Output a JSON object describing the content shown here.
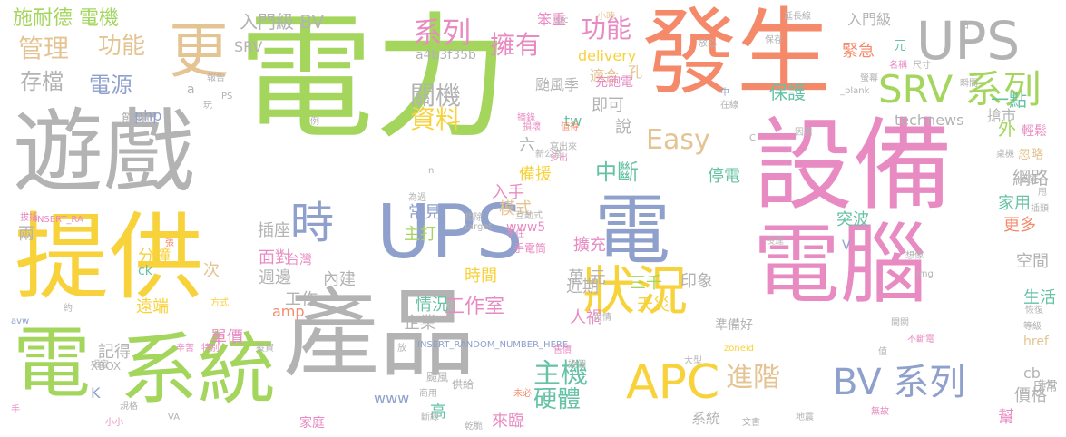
{
  "palette": {
    "green": "#a4d65e",
    "orange": "#f58a6a",
    "pink": "#e98bc3",
    "gray": "#b3b3b3",
    "yellow": "#f8d23a",
    "blue": "#8ea0cb",
    "tan": "#e4c493",
    "teal": "#66c2a5"
  },
  "words": [
    {
      "text": "電力",
      "color": "green"
    },
    {
      "text": "發生",
      "color": "orange"
    },
    {
      "text": "UPS",
      "color": "gray"
    },
    {
      "text": "遊戲",
      "color": "gray"
    },
    {
      "text": "設備",
      "color": "pink"
    },
    {
      "text": "提供",
      "color": "yellow"
    },
    {
      "text": "電腦",
      "color": "pink"
    },
    {
      "text": "產品",
      "color": "gray"
    },
    {
      "text": "UPS",
      "color": "blue"
    },
    {
      "text": "電",
      "color": "blue"
    },
    {
      "text": "系統",
      "color": "green"
    },
    {
      "text": "電",
      "color": "green"
    },
    {
      "text": "更",
      "color": "tan"
    },
    {
      "text": "時",
      "color": "blue"
    },
    {
      "text": "狀況",
      "color": "yellow"
    },
    {
      "text": "APC",
      "color": "yellow"
    },
    {
      "text": "SRV 系列",
      "color": "green"
    },
    {
      "text": "BV 系列",
      "color": "blue"
    },
    {
      "text": "Easy",
      "color": "tan"
    },
    {
      "text": "施耐德 電機",
      "color": "green"
    },
    {
      "text": "管理",
      "color": "tan"
    },
    {
      "text": "功能",
      "color": "tan"
    },
    {
      "text": "存檔",
      "color": "gray"
    },
    {
      "text": "電源",
      "color": "blue"
    },
    {
      "text": "系列",
      "color": "pink"
    },
    {
      "text": "擁有",
      "color": "pink"
    },
    {
      "text": "功能",
      "color": "pink"
    },
    {
      "text": "入門級 BV",
      "color": "gray"
    },
    {
      "text": "SRV",
      "color": "gray"
    },
    {
      "text": "a4b3f35b",
      "color": "gray"
    },
    {
      "text": "關機",
      "color": "gray"
    },
    {
      "text": "資料",
      "color": "yellow"
    },
    {
      "text": "中斷",
      "color": "teal"
    },
    {
      "text": "主機",
      "color": "teal"
    },
    {
      "text": "硬體",
      "color": "teal"
    },
    {
      "text": "進階",
      "color": "tan"
    },
    {
      "text": "緊急",
      "color": "orange"
    },
    {
      "text": "保護",
      "color": "teal"
    },
    {
      "text": "入門級",
      "color": "gray"
    },
    {
      "text": "元",
      "color": "teal"
    },
    {
      "text": "笨重",
      "color": "pink"
    },
    {
      "text": "delivery",
      "color": "yellow"
    },
    {
      "text": "適合",
      "color": "tan"
    },
    {
      "text": "孔",
      "color": "tan"
    },
    {
      "text": "颱風季",
      "color": "gray"
    },
    {
      "text": "外",
      "color": "green"
    },
    {
      "text": "一點",
      "color": "teal"
    },
    {
      "text": "網路",
      "color": "gray"
    },
    {
      "text": "停電",
      "color": "teal"
    },
    {
      "text": "technews",
      "color": "gray"
    },
    {
      "text": "搶市",
      "color": "gray"
    },
    {
      "text": "備援",
      "color": "yellow"
    },
    {
      "text": "插座",
      "color": "gray"
    },
    {
      "text": "面對",
      "color": "pink"
    },
    {
      "text": "週邊",
      "color": "gray"
    },
    {
      "text": "常見",
      "color": "blue"
    },
    {
      "text": "主打",
      "color": "green"
    },
    {
      "text": "模式",
      "color": "tan"
    },
    {
      "text": "www5",
      "color": "pink"
    },
    {
      "text": "分鐘",
      "color": "yellow"
    },
    {
      "text": "擴充",
      "color": "pink"
    },
    {
      "text": "時間",
      "color": "yellow"
    },
    {
      "text": "萬 元",
      "color": "gray"
    },
    {
      "text": "三千",
      "color": "green"
    },
    {
      "text": "印象",
      "color": "gray"
    },
    {
      "text": "突波",
      "color": "teal"
    },
    {
      "text": "家用",
      "color": "teal"
    },
    {
      "text": "更多",
      "color": "orange"
    },
    {
      "text": "空間",
      "color": "gray"
    },
    {
      "text": "生活",
      "color": "teal"
    },
    {
      "text": "工作室",
      "color": "pink"
    },
    {
      "text": "天災",
      "color": "yellow"
    },
    {
      "text": "工作",
      "color": "gray"
    },
    {
      "text": "內建",
      "color": "gray"
    },
    {
      "text": "台灣",
      "color": "pink"
    },
    {
      "text": "情況",
      "color": "teal"
    },
    {
      "text": "企業",
      "color": "gray"
    },
    {
      "text": "人禍",
      "color": "pink"
    },
    {
      "text": "近期",
      "color": "gray"
    },
    {
      "text": "遠端",
      "color": "yellow"
    },
    {
      "text": "單價",
      "color": "pink"
    },
    {
      "text": "記得",
      "color": "gray"
    },
    {
      "text": "amp",
      "color": "orange"
    },
    {
      "text": "次",
      "color": "tan"
    },
    {
      "text": "php",
      "color": "blue"
    },
    {
      "text": "tw",
      "color": "teal"
    },
    {
      "text": "說",
      "color": "gray"
    },
    {
      "text": "即可",
      "color": "gray"
    },
    {
      "text": "www",
      "color": "blue"
    },
    {
      "text": "家庭",
      "color": "pink"
    },
    {
      "text": "系統",
      "color": "gray"
    },
    {
      "text": "高",
      "color": "teal"
    },
    {
      "text": "來臨",
      "color": "pink"
    },
    {
      "text": "價格",
      "color": "gray"
    },
    {
      "text": "cb",
      "color": "gray"
    },
    {
      "text": "K",
      "color": "blue"
    },
    {
      "text": "兩",
      "color": "gray"
    },
    {
      "text": "ck",
      "color": "teal"
    },
    {
      "text": "六",
      "color": "gray"
    },
    {
      "text": "簡單",
      "color": "gray"
    },
    {
      "text": "a",
      "color": "gray"
    },
    {
      "text": "入手",
      "color": "pink"
    },
    {
      "text": "充飽電",
      "color": "pink"
    },
    {
      "text": "忽略",
      "color": "tan"
    },
    {
      "text": "輕鬆",
      "color": "pink"
    },
    {
      "text": "準備好",
      "color": "gray"
    },
    {
      "text": "日常",
      "color": "gray"
    },
    {
      "text": "幫",
      "color": "pink"
    },
    {
      "text": "V",
      "color": "blue"
    },
    {
      "text": "href",
      "color": "tan"
    },
    {
      "text": "INSERT_RANDOM_NUMBER_HERE",
      "color": "blue"
    },
    {
      "text": "XBOX",
      "color": "gray"
    },
    {
      "text": "手電筒",
      "color": "pink"
    },
    {
      "text": "供給",
      "color": "gray"
    },
    {
      "text": "颱風",
      "color": "gray"
    },
    {
      "text": "src",
      "color": "gray"
    },
    {
      "text": "小時",
      "color": "tan"
    },
    {
      "text": "報告",
      "color": "gray"
    },
    {
      "text": "img",
      "color": "gray"
    },
    {
      "text": "INSERT_RA",
      "color": "pink"
    },
    {
      "text": "target",
      "color": "gray"
    },
    {
      "text": "zoneid",
      "color": "yellow"
    },
    {
      "text": "_blank",
      "color": "gray"
    },
    {
      "text": "avw",
      "color": "blue"
    },
    {
      "text": "拔插",
      "color": "pink"
    },
    {
      "text": "約",
      "color": "gray"
    },
    {
      "text": "手",
      "color": "pink"
    },
    {
      "text": "為過",
      "color": "gray"
    },
    {
      "text": "相除",
      "color": "gray"
    },
    {
      "text": "互動式",
      "color": "gray"
    },
    {
      "text": "不住",
      "color": "pink"
    },
    {
      "text": "未必",
      "color": "orange"
    },
    {
      "text": "相宜",
      "color": "gray"
    },
    {
      "text": "辛苦",
      "color": "pink"
    },
    {
      "text": "投資",
      "color": "gray"
    },
    {
      "text": "特別",
      "color": "pink"
    },
    {
      "text": "方式",
      "color": "yellow"
    },
    {
      "text": "放",
      "color": "gray"
    },
    {
      "text": "商用",
      "color": "gray"
    },
    {
      "text": "斷線",
      "color": "gray"
    },
    {
      "text": "乾脆",
      "color": "gray"
    },
    {
      "text": "無故",
      "color": "pink"
    },
    {
      "text": "地震",
      "color": "gray"
    },
    {
      "text": "告知",
      "color": "gray"
    },
    {
      "text": "不斷電",
      "color": "pink"
    },
    {
      "text": "桌機",
      "color": "gray"
    },
    {
      "text": "因素",
      "color": "gray"
    },
    {
      "text": "延長線",
      "color": "gray"
    },
    {
      "text": "放心",
      "color": "gray"
    },
    {
      "text": "名稱",
      "color": "pink"
    },
    {
      "text": "尺寸",
      "color": "gray"
    },
    {
      "text": "佔",
      "color": "gray"
    },
    {
      "text": "瞬間",
      "color": "gray"
    },
    {
      "text": "寫出來",
      "color": "gray"
    },
    {
      "text": "多出",
      "color": "pink"
    },
    {
      "text": "損壞",
      "color": "pink"
    },
    {
      "text": "值得",
      "color": "orange"
    },
    {
      "text": "保存",
      "color": "gray"
    },
    {
      "text": "玩",
      "color": "gray"
    },
    {
      "text": "PS",
      "color": "gray"
    },
    {
      "text": "中",
      "color": "blue"
    },
    {
      "text": "在線",
      "color": "gray"
    },
    {
      "text": "螢幕",
      "color": "gray"
    },
    {
      "text": "災情",
      "color": "gray"
    },
    {
      "text": "摘錄",
      "color": "pink"
    },
    {
      "text": "新公室",
      "color": "gray"
    },
    {
      "text": "售價",
      "color": "pink"
    },
    {
      "text": "大型",
      "color": "gray"
    },
    {
      "text": "換個",
      "color": "gray"
    },
    {
      "text": "長達",
      "color": "gray"
    },
    {
      "text": "想像",
      "color": "gray"
    },
    {
      "text": "恢復",
      "color": "gray"
    },
    {
      "text": "等級",
      "color": "gray"
    },
    {
      "text": "開關",
      "color": "gray"
    },
    {
      "text": "品質",
      "color": "gray"
    },
    {
      "text": "插頭",
      "color": "gray"
    },
    {
      "text": "甩",
      "color": "gray"
    },
    {
      "text": "例",
      "color": "gray"
    },
    {
      "text": "值",
      "color": "gray"
    },
    {
      "text": "張",
      "color": "orange"
    },
    {
      "text": "文書",
      "color": "gray"
    },
    {
      "text": "規格",
      "color": "gray"
    },
    {
      "text": "小小",
      "color": "pink"
    },
    {
      "text": "VA",
      "color": "gray"
    },
    {
      "text": "n",
      "color": "gray"
    },
    {
      "text": "C",
      "color": "gray"
    }
  ]
}
